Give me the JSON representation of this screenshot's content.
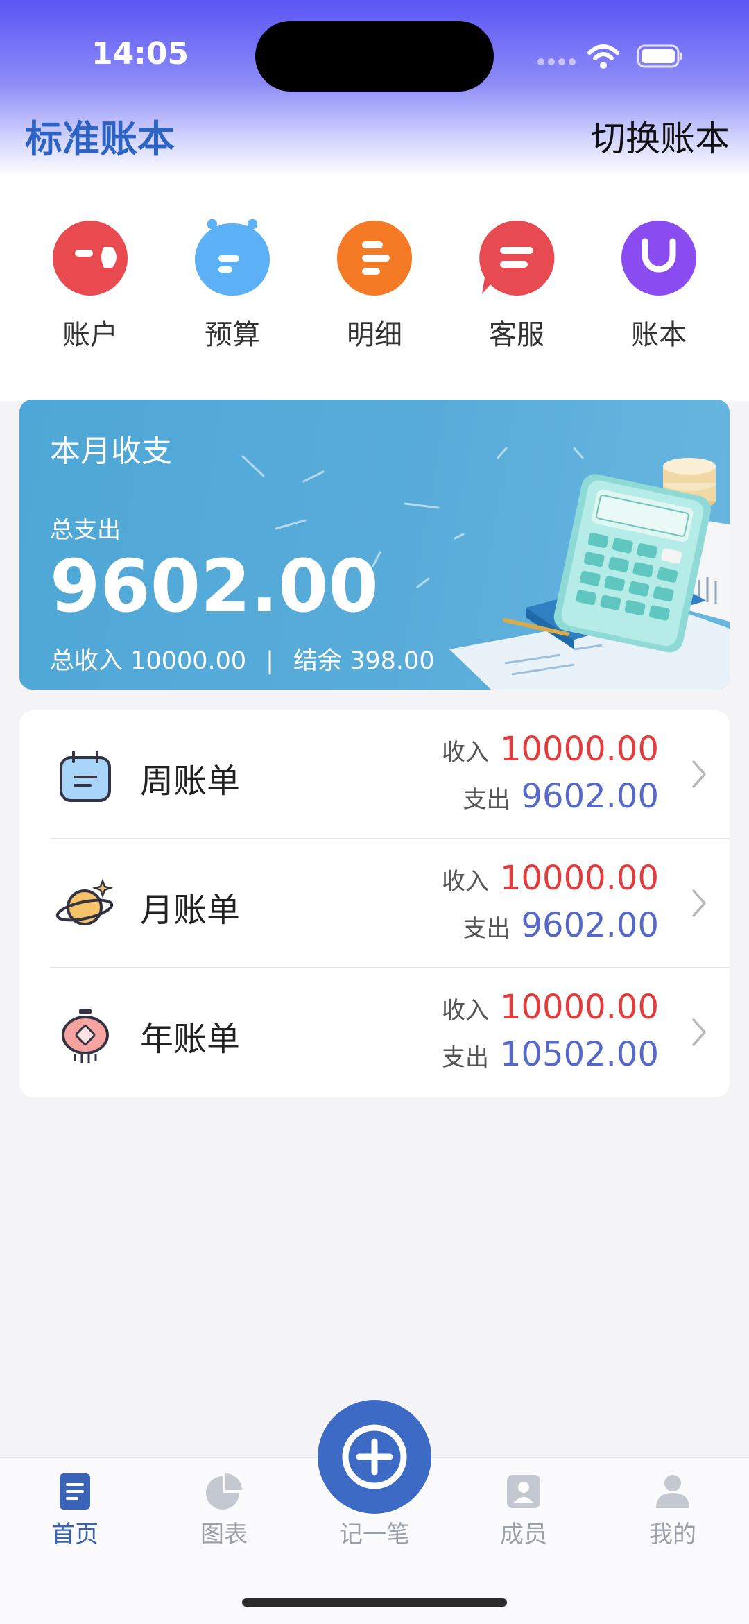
{
  "status_bar": {
    "time": "14:05"
  },
  "header": {
    "title": "标准账本",
    "switch_label": "切换账本"
  },
  "quick_actions": [
    {
      "label": "账户",
      "icon": "wallet-icon",
      "color": "#e84a50"
    },
    {
      "label": "预算",
      "icon": "budget-icon",
      "color": "#5cb0f5"
    },
    {
      "label": "明细",
      "icon": "list-icon",
      "color": "#f47a26"
    },
    {
      "label": "客服",
      "icon": "chat-icon",
      "color": "#e84a52"
    },
    {
      "label": "账本",
      "icon": "book-icon",
      "color": "#8a4cf0"
    }
  ],
  "month_card": {
    "title": "本月收支",
    "expense_label": "总支出",
    "expense_value": "9602.00",
    "income_label": "总收入",
    "income_value": "10000.00",
    "separator": "|",
    "balance_label": "结余",
    "balance_value": "398.00"
  },
  "bills": [
    {
      "name": "周账单",
      "icon": "calendar-icon",
      "income_label": "收入",
      "income": "10000.00",
      "expense_label": "支出",
      "expense": "9602.00"
    },
    {
      "name": "月账单",
      "icon": "planet-icon",
      "income_label": "收入",
      "income": "10000.00",
      "expense_label": "支出",
      "expense": "9602.00"
    },
    {
      "name": "年账单",
      "icon": "lantern-icon",
      "income_label": "收入",
      "income": "10000.00",
      "expense_label": "支出",
      "expense": "10502.00"
    }
  ],
  "tabs": [
    {
      "label": "首页",
      "icon": "home-doc-icon",
      "active": true
    },
    {
      "label": "图表",
      "icon": "pie-chart-icon",
      "active": false
    },
    {
      "label": "记一笔",
      "icon": "plus-icon",
      "active": false
    },
    {
      "label": "成员",
      "icon": "member-icon",
      "active": false
    },
    {
      "label": "我的",
      "icon": "profile-icon",
      "active": false
    }
  ],
  "colors": {
    "accent": "#3d6ac4",
    "income": "#e33c3c",
    "expense": "#5669c9",
    "card": "#4ea7d6"
  }
}
